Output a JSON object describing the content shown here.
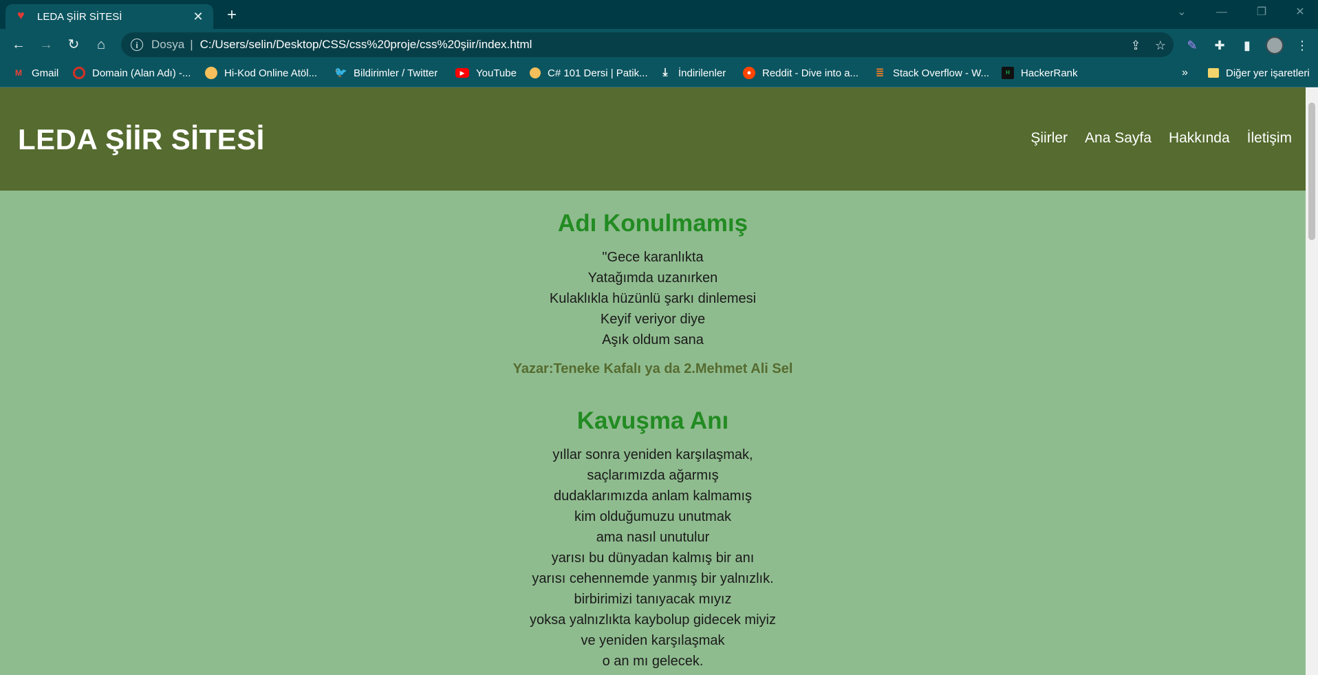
{
  "browser": {
    "tab_title": "LEDA ŞİİR SİTESİ",
    "address_scheme": "Dosya",
    "address_url": "C:/Users/selin/Desktop/CSS/css%20proje/css%20şiir/index.html",
    "bookmarks": [
      {
        "label": "Gmail",
        "icon": "gmail-icon",
        "color": "#ea4335"
      },
      {
        "label": "Domain (Alan Adı) -...",
        "icon": "domain-icon",
        "color": "#d93025"
      },
      {
        "label": "Hi-Kod Online Atöl...",
        "icon": "hikod-icon",
        "color": "#f6bf5b"
      },
      {
        "label": "Bildirimler / Twitter",
        "icon": "twitter-icon",
        "color": "#1d9bf0"
      },
      {
        "label": "YouTube",
        "icon": "youtube-icon",
        "color": "#ff0000"
      },
      {
        "label": "C# 101 Dersi | Patik...",
        "icon": "patika-icon",
        "color": "#f6bf5b"
      },
      {
        "label": "İndirilenler",
        "icon": "download-icon",
        "color": "#ffffff"
      },
      {
        "label": "Reddit - Dive into a...",
        "icon": "reddit-icon",
        "color": "#ff4500"
      },
      {
        "label": "Stack Overflow - W...",
        "icon": "stackoverflow-icon",
        "color": "#f48024"
      },
      {
        "label": "HackerRank",
        "icon": "hackerrank-icon",
        "color": "#111111"
      }
    ],
    "other_bookmarks": "Diğer yer işaretleri",
    "overflow_label": "»"
  },
  "site": {
    "title": "LEDA ŞİİR SİTESİ",
    "nav": [
      "Şiirler",
      "Ana Sayfa",
      "Hakkında",
      "İletişim"
    ],
    "colors": {
      "header": "#556b2f",
      "background": "#8fbc8f",
      "poem_title": "#228b22",
      "author": "#556b2f"
    }
  },
  "poems": [
    {
      "title": "Adı Konulmamış",
      "lines": [
        "\"Gece karanlıkta",
        "Yatağımda uzanırken",
        "Kulaklıkla hüzünlü şarkı dinlemesi",
        "Keyif veriyor diye",
        "Aşık oldum sana"
      ],
      "author": "Yazar:Teneke Kafalı ya da 2.Mehmet Ali Sel"
    },
    {
      "title": "Kavuşma Anı",
      "lines": [
        "yıllar sonra yeniden karşılaşmak,",
        "saçlarımızda ağarmış",
        "dudaklarımızda anlam kalmamış",
        "kim olduğumuzu unutmak",
        "ama nasıl unutulur",
        "yarısı bu dünyadan kalmış bir anı",
        "yarısı cehennemde yanmış bir yalnızlık.",
        "birbirimizi tanıyacak mıyız",
        "yoksa yalnızlıkta kaybolup gidecek miyiz",
        "ve yeniden karşılaşmak",
        "o an mı gelecek."
      ]
    }
  ]
}
